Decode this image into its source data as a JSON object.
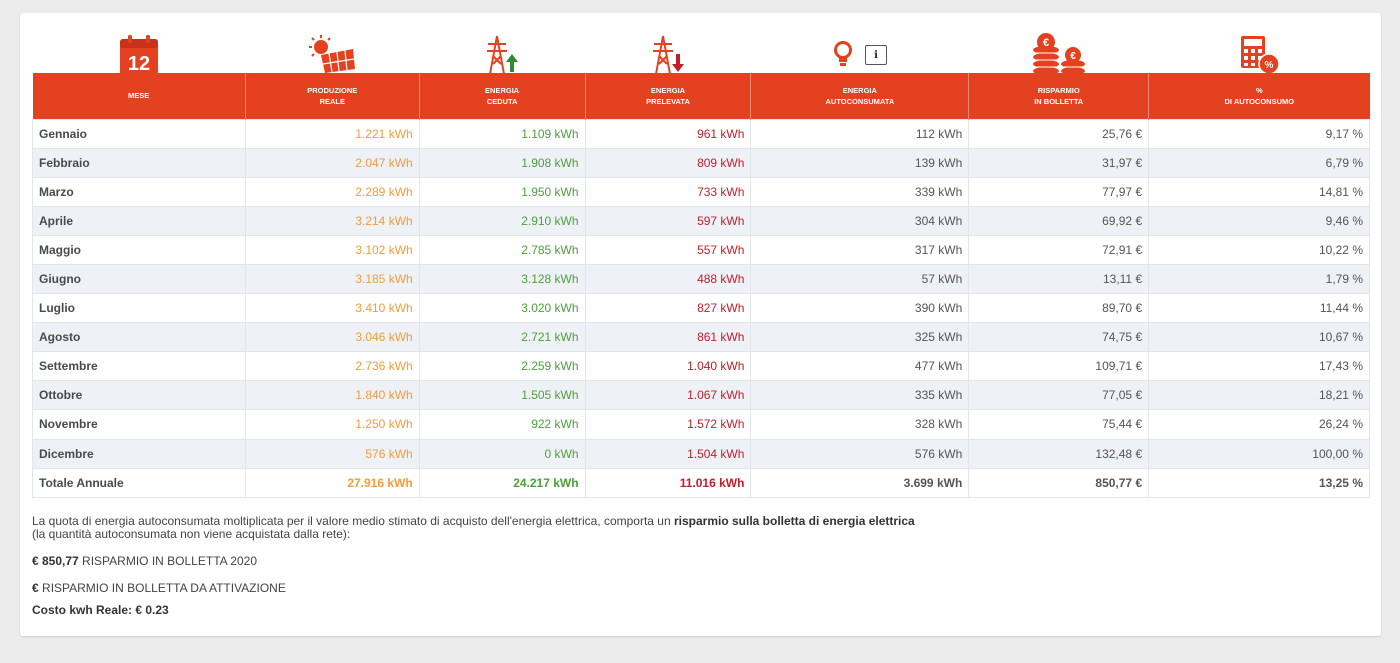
{
  "icons": {
    "calendar_number": "12",
    "info_glyph": "i",
    "euro_glyph": "€",
    "percent_glyph": "%"
  },
  "table": {
    "headers": [
      [
        "MESE"
      ],
      [
        "PRODUZIONE",
        "REALE"
      ],
      [
        "ENERGIA",
        "CEDUTA"
      ],
      [
        "ENERGIA",
        "PRELEVATA"
      ],
      [
        "ENERGIA",
        "AUTOCONSUMATA"
      ],
      [
        "RISPARMIO",
        "IN BOLLETTA"
      ],
      [
        "%",
        "DI AUTOCONSUMO"
      ]
    ],
    "rows": [
      [
        "Gennaio",
        "1.221 kWh",
        "1.109 kWh",
        "961 kWh",
        "112 kWh",
        "25,76 €",
        "9,17 %"
      ],
      [
        "Febbraio",
        "2.047 kWh",
        "1.908 kWh",
        "809 kWh",
        "139 kWh",
        "31,97 €",
        "6,79 %"
      ],
      [
        "Marzo",
        "2.289 kWh",
        "1.950 kWh",
        "733 kWh",
        "339 kWh",
        "77,97 €",
        "14,81 %"
      ],
      [
        "Aprile",
        "3.214 kWh",
        "2.910 kWh",
        "597 kWh",
        "304 kWh",
        "69,92 €",
        "9,46 %"
      ],
      [
        "Maggio",
        "3.102 kWh",
        "2.785 kWh",
        "557 kWh",
        "317 kWh",
        "72,91 €",
        "10,22 %"
      ],
      [
        "Giugno",
        "3.185 kWh",
        "3.128 kWh",
        "488 kWh",
        "57 kWh",
        "13,11 €",
        "1,79 %"
      ],
      [
        "Luglio",
        "3.410 kWh",
        "3.020 kWh",
        "827 kWh",
        "390 kWh",
        "89,70 €",
        "11,44 %"
      ],
      [
        "Agosto",
        "3.046 kWh",
        "2.721 kWh",
        "861 kWh",
        "325 kWh",
        "74,75 €",
        "10,67 %"
      ],
      [
        "Settembre",
        "2.736 kWh",
        "2.259 kWh",
        "1.040 kWh",
        "477 kWh",
        "109,71 €",
        "17,43 %"
      ],
      [
        "Ottobre",
        "1.840 kWh",
        "1.505 kWh",
        "1.067 kWh",
        "335 kWh",
        "77,05 €",
        "18,21 %"
      ],
      [
        "Novembre",
        "1.250 kWh",
        "922 kWh",
        "1.572 kWh",
        "328 kWh",
        "75,44 €",
        "26,24 %"
      ],
      [
        "Dicembre",
        "576 kWh",
        "0 kWh",
        "1.504 kWh",
        "576 kWh",
        "132,48 €",
        "100,00 %"
      ]
    ],
    "total": [
      "Totale Annuale",
      "27.916 kWh",
      "24.217 kWh",
      "11.016 kWh",
      "3.699 kWh",
      "850,77 €",
      "13,25 %"
    ]
  },
  "notes": {
    "line1_text": "La quota di energia autoconsumata moltiplicata per il valore medio stimato di acquisto dell'energia elettrica, comporta un ",
    "line1_bold": "risparmio sulla bolletta di energia elettrica",
    "line1_sub": "(la quantità autoconsumata non viene acquistata dalla rete):",
    "saving_amount": "€ 850,77",
    "saving_label": " RISPARMIO IN BOLLETTA 2020",
    "activation_currency": "€",
    "activation_label": " RISPARMIO IN BOLLETTA DA ATTIVAZIONE",
    "cost_label": "Costo kwh Reale: € 0.23"
  },
  "colors": {
    "header_bg": "#e3411f",
    "produzione": "#f39c3a",
    "ceduta": "#4ea03c",
    "prelevata": "#c0202d"
  }
}
